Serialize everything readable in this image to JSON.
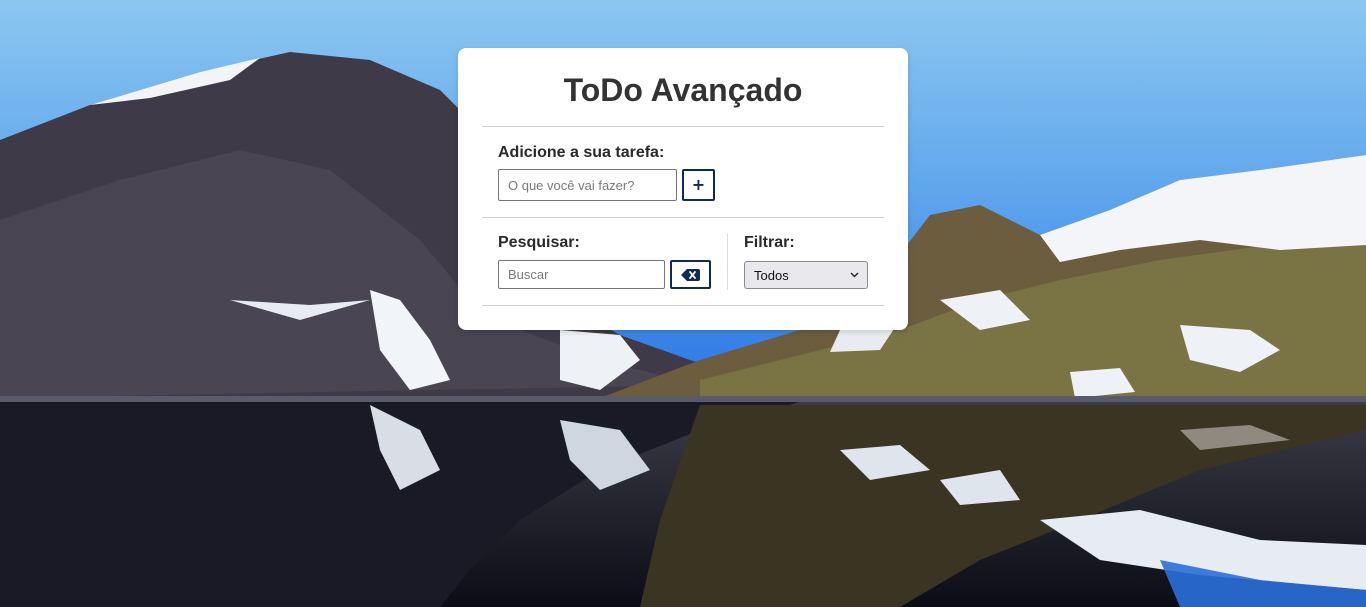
{
  "app": {
    "title": "ToDo Avançado"
  },
  "add_task": {
    "label": "Adicione a sua tarefa:",
    "input_placeholder": "O que você vai fazer?",
    "input_value": "",
    "button_icon": "plus-icon",
    "button_symbol": "+"
  },
  "search": {
    "label": "Pesquisar:",
    "input_placeholder": "Buscar",
    "input_value": "",
    "clear_button_icon": "backspace-icon"
  },
  "filter": {
    "label": "Filtrar:",
    "selected": "Todos",
    "chevron_icon": "chevron-down-icon"
  },
  "colors": {
    "card_background": "#ffffff",
    "title_text": "#333333",
    "button_border": "#0f2a55",
    "sky_top": "#8cc7f0",
    "sky_bottom": "#2a6fda"
  },
  "background": {
    "subject": "snowy mountains reflected in a lake"
  }
}
